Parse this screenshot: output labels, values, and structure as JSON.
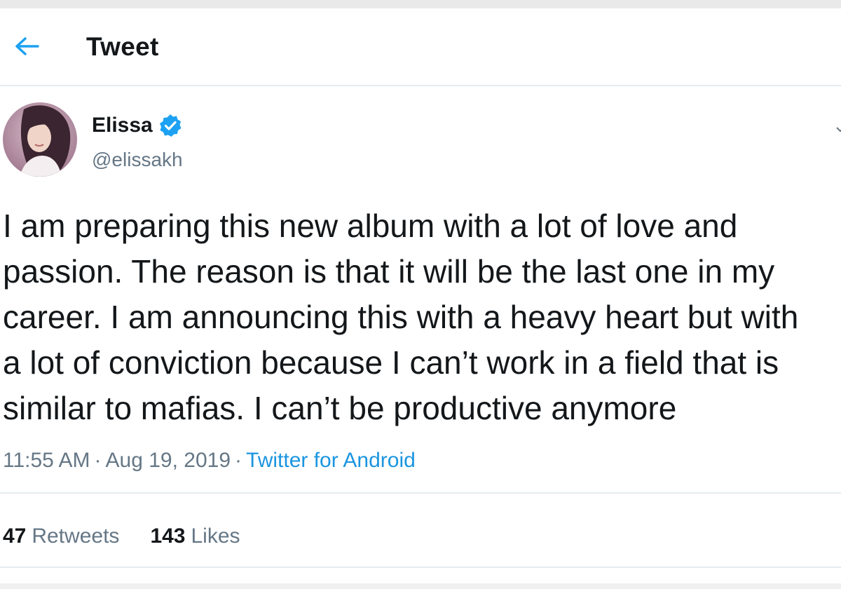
{
  "header": {
    "title": "Tweet",
    "back_icon": "arrow-left-icon"
  },
  "author": {
    "display_name": "Elissa",
    "handle": "@elissakh",
    "verified": true,
    "avatar_icon": "avatar-photo",
    "verified_color": "#1da1f2"
  },
  "tweet": {
    "lines": [
      "I am preparing this new album with a lot of love and",
      "passion. The reason is that it will be the last one in my",
      "career. I am announcing this with a heavy heart but with",
      "a lot of conviction because I can’t work in a field that is",
      "similar to mafias. I can’t be productive anymore"
    ],
    "time": "11:55 AM",
    "date": "Aug 19, 2019",
    "separator": "·",
    "source": "Twitter for Android"
  },
  "stats": {
    "retweets_count": "47",
    "retweets_label": "Retweets",
    "likes_count": "143",
    "likes_label": "Likes"
  },
  "colors": {
    "accent": "#1da1f2",
    "link": "#1b95e0",
    "text": "#14171a",
    "secondary": "#657786"
  }
}
